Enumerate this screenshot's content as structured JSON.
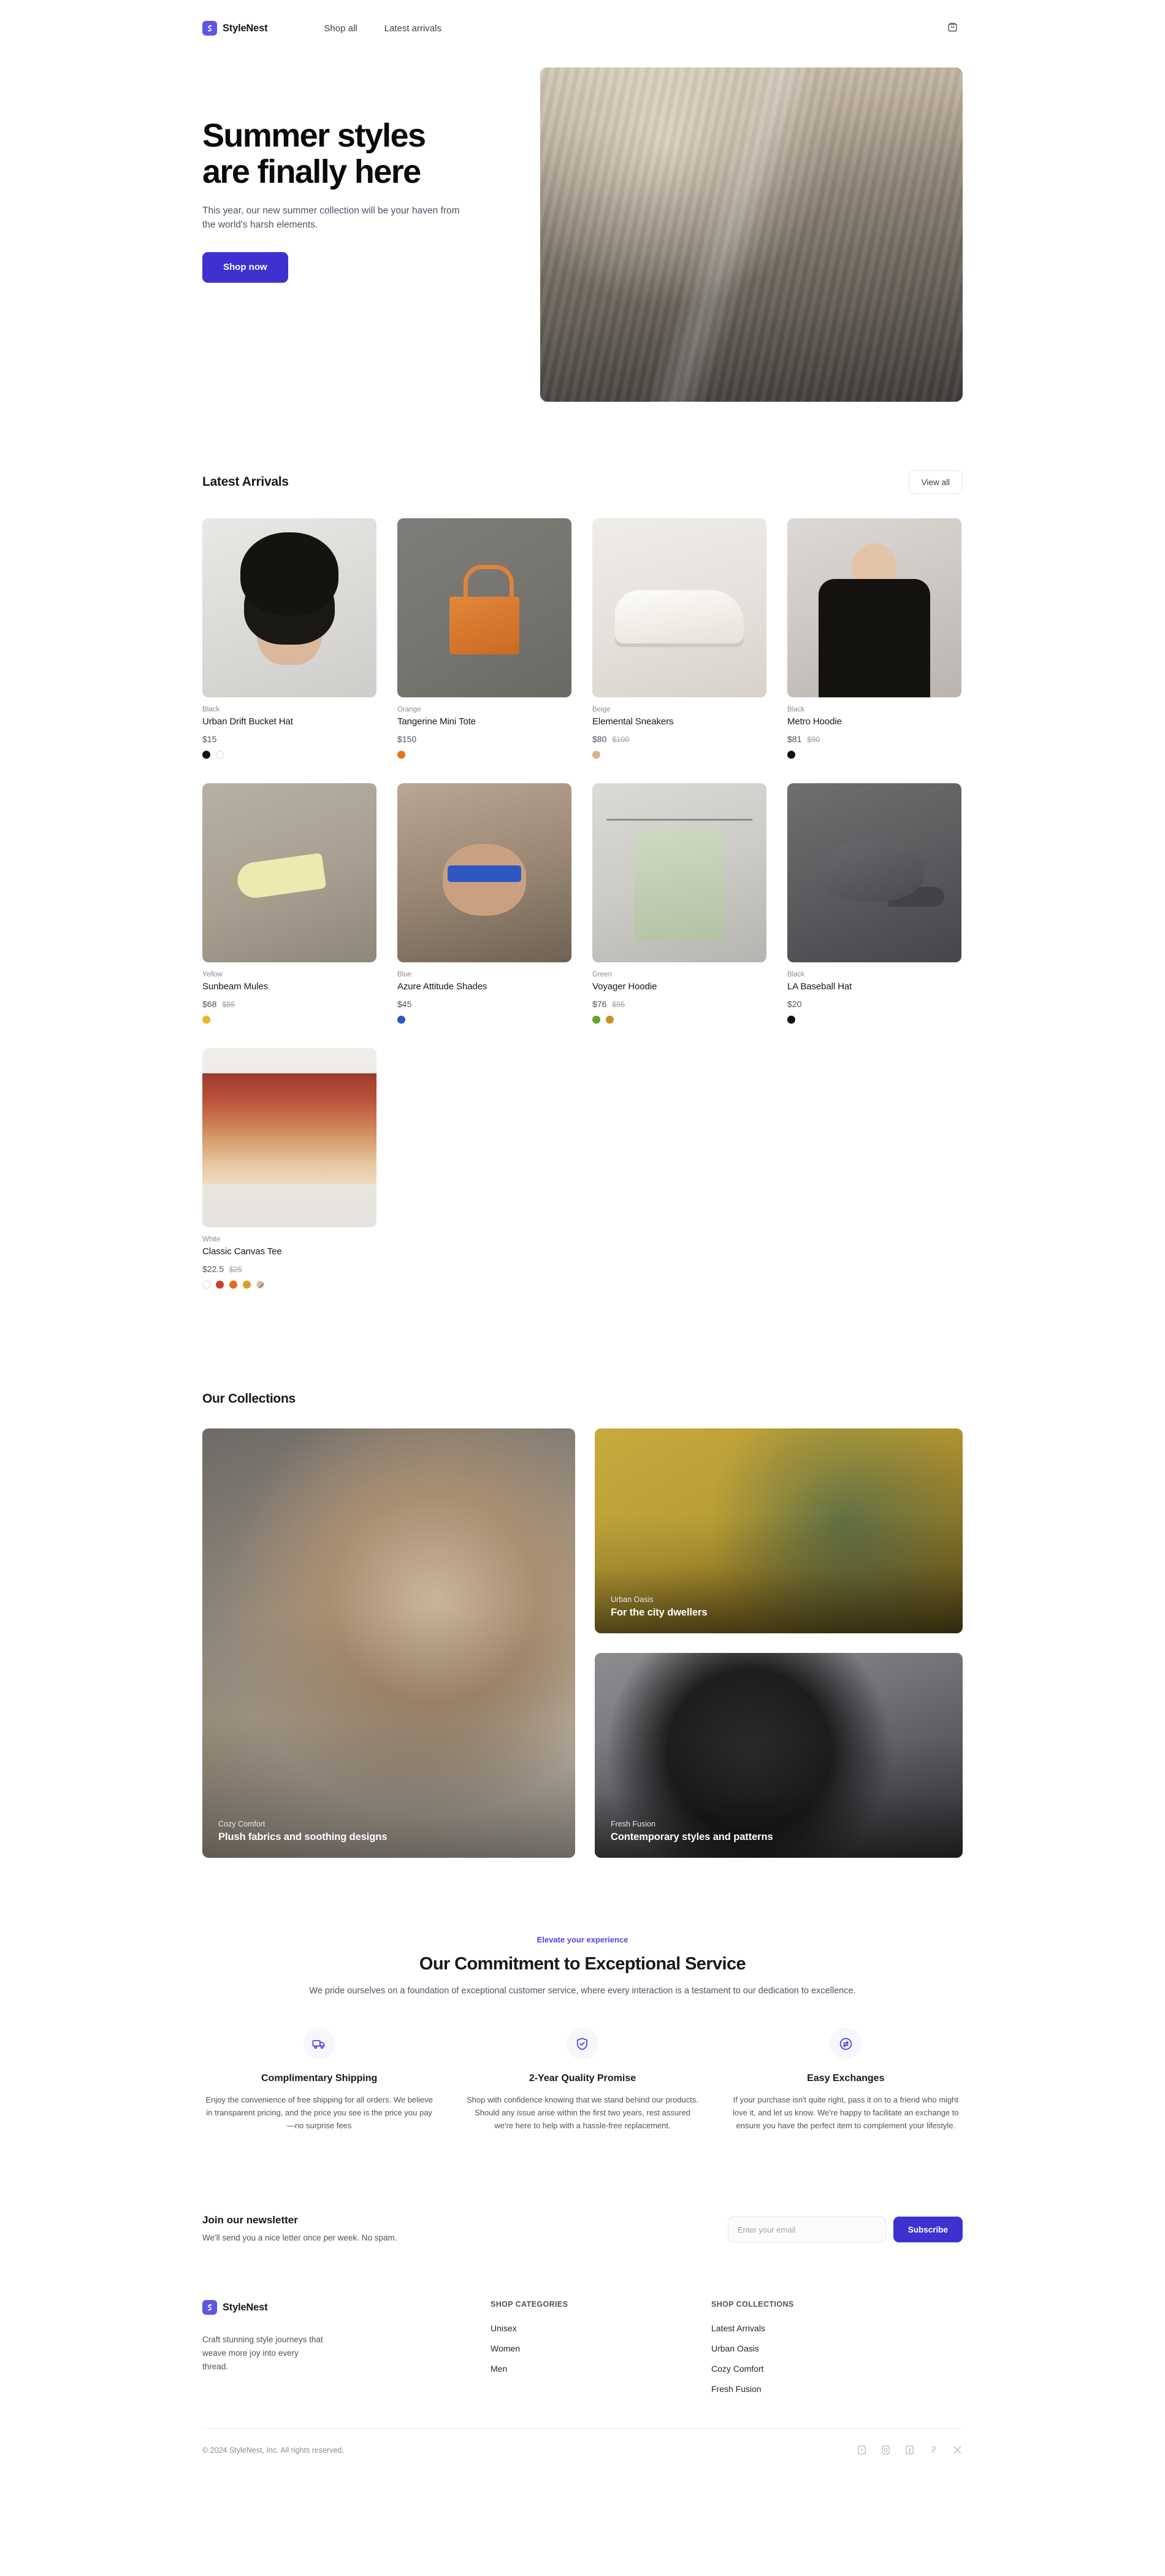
{
  "header": {
    "brand": "StyleNest",
    "nav": [
      {
        "label": "Shop all"
      },
      {
        "label": "Latest arrivals"
      }
    ],
    "cart_icon": "shopping-bag-icon"
  },
  "hero": {
    "title_line1": "Summer styles",
    "title_line2": "are finally here",
    "subtitle": "This year, our new summer collection will be your haven from the world's harsh elements.",
    "cta": "Shop now",
    "image_alt": "woman on escalator in shopping mall"
  },
  "latest_arrivals": {
    "title": "Latest Arrivals",
    "view_all": "View all",
    "products": [
      {
        "color": "Black",
        "name": "Urban Drift Bucket Hat",
        "price": "$15",
        "was": "",
        "swatches": [
          "#111111",
          "#ffffff"
        ],
        "swatch_styles": [
          "solid",
          "ring"
        ],
        "image": "ph-buckethat"
      },
      {
        "color": "Orange",
        "name": "Tangerine Mini Tote",
        "price": "$150",
        "was": "",
        "swatches": [
          "#e2751f"
        ],
        "swatch_styles": [
          "solid"
        ],
        "image": "ph-tote"
      },
      {
        "color": "Beige",
        "name": "Elemental Sneakers",
        "price": "$80",
        "was": "$100",
        "swatches": [
          "#d8b48c"
        ],
        "swatch_styles": [
          "solid"
        ],
        "image": "ph-sneaker"
      },
      {
        "color": "Black",
        "name": "Metro Hoodie",
        "price": "$81",
        "was": "$90",
        "swatches": [
          "#111111"
        ],
        "swatch_styles": [
          "solid"
        ],
        "image": "ph-metrohoodie"
      },
      {
        "color": "Yellow",
        "name": "Sunbeam Mules",
        "price": "$68",
        "was": "$85",
        "swatches": [
          "#e8b628"
        ],
        "swatch_styles": [
          "solid"
        ],
        "image": "ph-mules"
      },
      {
        "color": "Blue",
        "name": "Azure Attitude Shades",
        "price": "$45",
        "was": "",
        "swatches": [
          "#2f57c4"
        ],
        "swatch_styles": [
          "solid"
        ],
        "image": "ph-shades"
      },
      {
        "color": "Green",
        "name": "Voyager Hoodie",
        "price": "$76",
        "was": "$95",
        "swatches": [
          "#64a12f",
          "#cf8c2a"
        ],
        "swatch_styles": [
          "solid",
          "solid"
        ],
        "image": "ph-voyager"
      },
      {
        "color": "Black",
        "name": "LA Baseball Hat",
        "price": "$20",
        "was": "",
        "swatches": [
          "#111111"
        ],
        "swatch_styles": [
          "solid"
        ],
        "image": "ph-labaseball"
      },
      {
        "color": "White",
        "name": "Classic Canvas Tee",
        "price": "$22.5",
        "was": "$25",
        "swatches": [
          "#ffffff",
          "#d33a2c",
          "#e8691b",
          "#d6a020",
          "#d6bc9a"
        ],
        "swatch_styles": [
          "ring",
          "solid",
          "solid",
          "solid",
          "slash"
        ],
        "image": "ph-canvastee"
      }
    ]
  },
  "collections": {
    "title": "Our Collections",
    "items": [
      {
        "kicker": "Cozy Comfort",
        "headline": "Plush fabrics and soothing designs",
        "image": "ph-cozy"
      },
      {
        "kicker": "Urban Oasis",
        "headline": "For the city dwellers",
        "image": "ph-urban"
      },
      {
        "kicker": "Fresh Fusion",
        "headline": "Contemporary styles and patterns",
        "image": "ph-fresh"
      }
    ]
  },
  "commitment": {
    "kicker": "Elevate your experience",
    "title": "Our Commitment to Exceptional Service",
    "subtitle": "We pride ourselves on a foundation of exceptional customer service, where every interaction is a testament to our dedication to excellence.",
    "features": [
      {
        "icon": "truck-icon",
        "title": "Complimentary Shipping",
        "description": "Enjoy the convenience of free shipping for all orders. We believe in transparent pricing, and the price you see is the price you pay—no surprise fees"
      },
      {
        "icon": "shield-check-icon",
        "title": "2-Year Quality Promise",
        "description": "Shop with confidence knowing that we stand behind our products. Should any issue arise within the first two years, rest assured we're here to help with a hassle-free replacement."
      },
      {
        "icon": "exchange-icon",
        "title": "Easy Exchanges",
        "description": "If your purchase isn't quite right, pass it on to a friend who might love it, and let us know. We're happy to facilitate an exchange to ensure you have the perfect item to complement your lifestyle."
      }
    ]
  },
  "newsletter": {
    "title": "Join our newsletter",
    "description": "We'll send you a nice letter once per week. No spam.",
    "placeholder": "Enter your email",
    "value": "",
    "button": "Subscribe"
  },
  "footer": {
    "brand": "StyleNest",
    "description": "Craft stunning style journeys that weave more joy into every thread.",
    "columns": [
      {
        "heading": "SHOP CATEGORIES",
        "links": [
          {
            "label": "Unisex"
          },
          {
            "label": "Women"
          },
          {
            "label": "Men"
          }
        ]
      },
      {
        "heading": "SHOP COLLECTIONS",
        "links": [
          {
            "label": "Latest Arrivals"
          },
          {
            "label": "Urban Oasis"
          },
          {
            "label": "Cozy Comfort"
          },
          {
            "label": "Fresh Fusion"
          }
        ]
      }
    ],
    "copyright": "© 2024 StyleNest, Inc. All rights reserved.",
    "socials": [
      {
        "name": "youtube-icon"
      },
      {
        "name": "instagram-icon"
      },
      {
        "name": "facebook-icon"
      },
      {
        "name": "pinterest-icon"
      },
      {
        "name": "x-icon"
      }
    ]
  },
  "theme": {
    "accent": "#3d32cf",
    "kicker_color": "#4f46e5",
    "brand_mark": "#5b57e0"
  }
}
